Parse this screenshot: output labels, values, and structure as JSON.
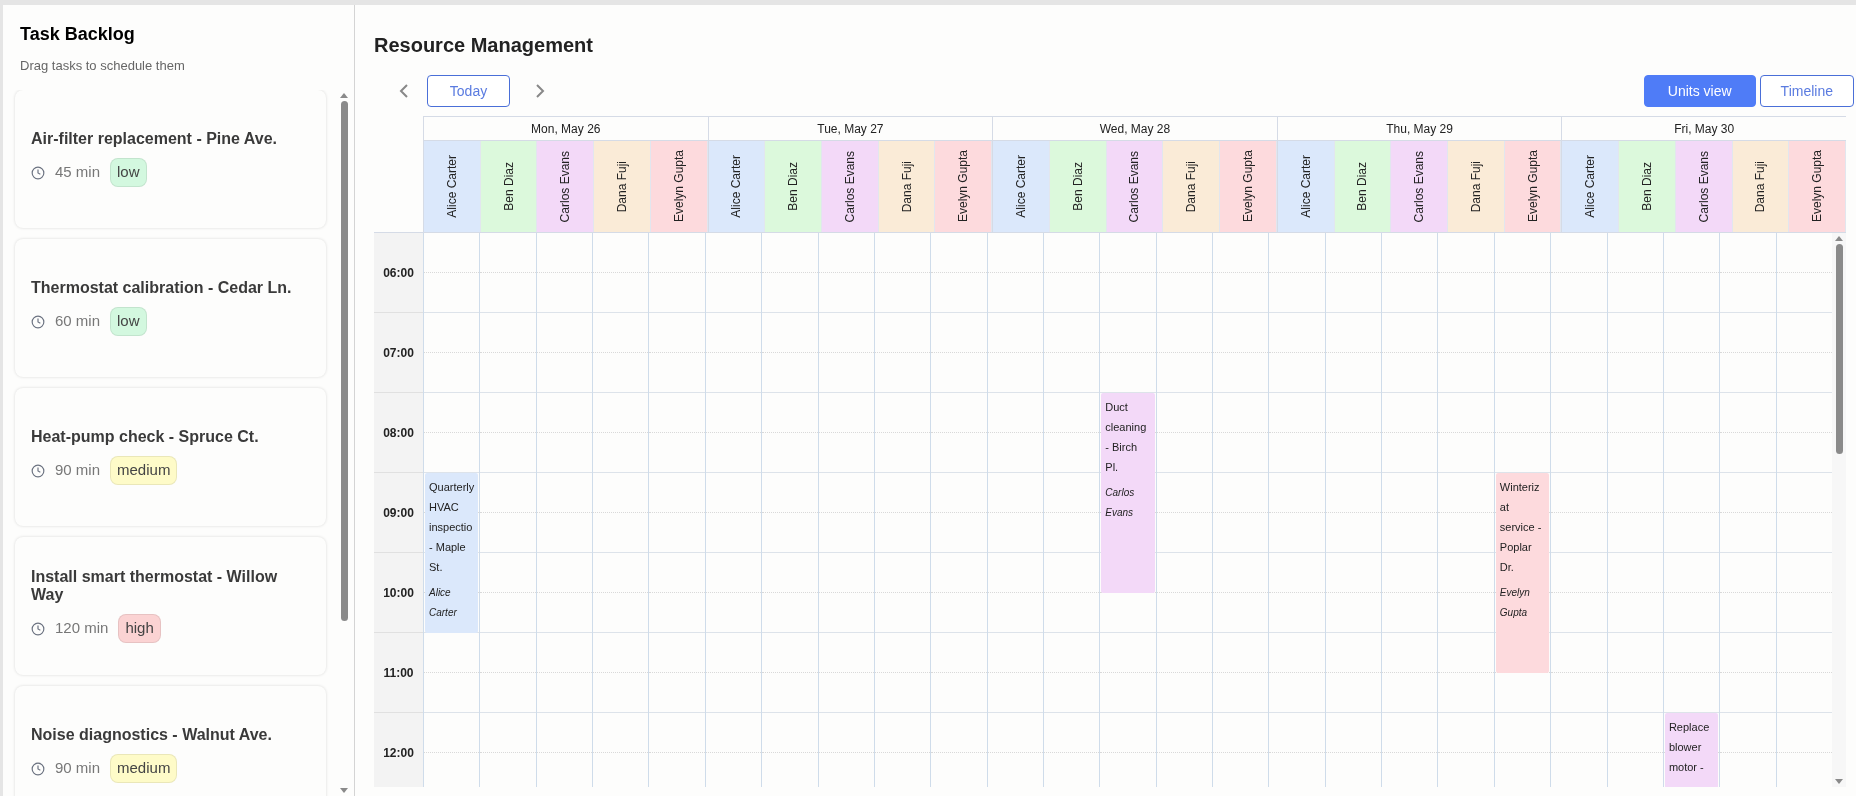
{
  "sidebar": {
    "title": "Task Backlog",
    "subtitle": "Drag tasks to schedule them",
    "tasks": [
      {
        "title": "Air-filter replacement - Pine Ave.",
        "duration": "45 min",
        "priority": "low",
        "color": "#d3f8df"
      },
      {
        "title": "Thermostat calibration - Cedar Ln.",
        "duration": "60 min",
        "priority": "low",
        "color": "#d3f8df"
      },
      {
        "title": "Heat-pump check - Spruce Ct.",
        "duration": "90 min",
        "priority": "medium",
        "color": "#fefbc8"
      },
      {
        "title": "Install smart thermostat - Willow Way",
        "duration": "120 min",
        "priority": "high",
        "color": "#fbd3d3"
      },
      {
        "title": "Noise diagnostics - Walnut Ave.",
        "duration": "90 min",
        "priority": "medium",
        "color": "#fefbc8"
      }
    ]
  },
  "main": {
    "title": "Resource Management",
    "today_button": "Today",
    "views": [
      {
        "label": "Units view",
        "selected": true
      },
      {
        "label": "Timeline",
        "selected": false
      }
    ],
    "hours": [
      "06:00",
      "07:00",
      "08:00",
      "09:00",
      "10:00",
      "11:00",
      "12:00"
    ],
    "days": [
      {
        "label": "Mon, May 26",
        "resources": [
          {
            "name": "Alice Carter",
            "color": "#dbe8fb",
            "events": [
              {
                "title": "Quarterly HVAC inspectio - Maple St.",
                "assignee": "Alice Carter"
              }
            ]
          },
          {
            "name": "Ben Diaz",
            "color": "#dcf9dc"
          },
          {
            "name": "Carlos Evans",
            "color": "#f3d9f8"
          },
          {
            "name": "Dana Fuji",
            "color": "#faebd7"
          },
          {
            "name": "Evelyn Gupta",
            "color": "#fddadd"
          }
        ]
      },
      {
        "label": "Tue, May 27",
        "resources": [
          {
            "name": "Alice Carter",
            "color": "#dbe8fb"
          },
          {
            "name": "Ben Diaz",
            "color": "#dcf9dc"
          },
          {
            "name": "Carlos Evans",
            "color": "#f3d9f8"
          },
          {
            "name": "Dana Fuji",
            "color": "#faebd7"
          },
          {
            "name": "Evelyn Gupta",
            "color": "#fddadd"
          }
        ]
      },
      {
        "label": "Wed, May 28",
        "resources": [
          {
            "name": "Alice Carter",
            "color": "#dbe8fb"
          },
          {
            "name": "Ben Diaz",
            "color": "#dcf9dc"
          },
          {
            "name": "Carlos Evans",
            "color": "#f3d9f8",
            "events": [
              {
                "title": "Duct cleaning - Birch Pl.",
                "assignee": "Carlos Evans"
              }
            ]
          },
          {
            "name": "Dana Fuji",
            "color": "#faebd7"
          },
          {
            "name": "Evelyn Gupta",
            "color": "#fddadd"
          }
        ]
      },
      {
        "label": "Thu, May 29",
        "resources": [
          {
            "name": "Alice Carter",
            "color": "#dbe8fb"
          },
          {
            "name": "Ben Diaz",
            "color": "#dcf9dc"
          },
          {
            "name": "Carlos Evans",
            "color": "#f3d9f8"
          },
          {
            "name": "Dana Fuji",
            "color": "#faebd7"
          },
          {
            "name": "Evelyn Gupta",
            "color": "#fddadd",
            "events": [
              {
                "title": "Winterizat service - Poplar Dr.",
                "assignee": "Evelyn Gupta"
              }
            ]
          }
        ]
      },
      {
        "label": "Fri, May 30",
        "resources": [
          {
            "name": "Alice Carter",
            "color": "#dbe8fb"
          },
          {
            "name": "Ben Diaz",
            "color": "#dcf9dc"
          },
          {
            "name": "Carlos Evans",
            "color": "#f3d9f8",
            "events": [
              {
                "title": "Replace blower motor -"
              }
            ]
          },
          {
            "name": "Dana Fuji",
            "color": "#faebd7"
          },
          {
            "name": "Evelyn Gupta",
            "color": "#fddadd"
          }
        ]
      }
    ]
  }
}
